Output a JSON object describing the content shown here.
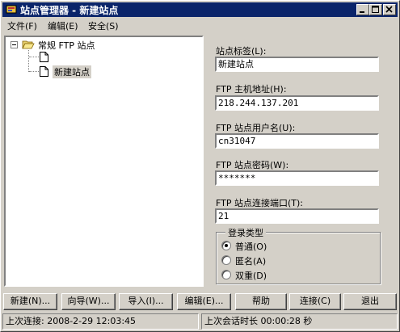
{
  "window": {
    "title": "站点管理器 - 新建站点"
  },
  "menu": [
    {
      "label": "文件(F)"
    },
    {
      "label": "编辑(E)"
    },
    {
      "label": "安全(S)"
    }
  ],
  "tree": {
    "root": "常规 FTP 站点",
    "children": [
      "",
      "新建站点"
    ]
  },
  "fields": {
    "label": {
      "label": "站点标签(L):",
      "value": "新建站点"
    },
    "host": {
      "label": "FTP 主机地址(H):",
      "value": "218.244.137.201"
    },
    "user": {
      "label": "FTP 站点用户名(U):",
      "value": "cn31047"
    },
    "password": {
      "label": "FTP 站点密码(W):",
      "value": "*******"
    },
    "port": {
      "label": "FTP 站点连接端口(T):",
      "value": "21"
    }
  },
  "login_type": {
    "title": "登录类型",
    "options": [
      {
        "label": "普通(O)",
        "selected": true
      },
      {
        "label": "匿名(A)",
        "selected": false
      },
      {
        "label": "双重(D)",
        "selected": false
      }
    ]
  },
  "buttons": {
    "new": "新建(N)...",
    "wizard": "向导(W)...",
    "import": "导入(I)...",
    "edit": "编辑(E)...",
    "help": "帮助",
    "connect": "连接(C)",
    "close": "退出"
  },
  "status": {
    "last_connect": "上次连接: 2008-2-29 12:03:45",
    "session_length": "上次会话时长 00:00:28 秒"
  },
  "colors": {
    "titlebar": "#0a246a",
    "face": "#d4d0c8"
  }
}
